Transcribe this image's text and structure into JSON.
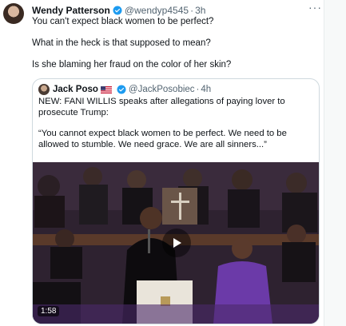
{
  "tweet": {
    "author_name": "Wendy Patterson",
    "author_handle": "@wendyp4545",
    "separator": "·",
    "time": "3h",
    "more_label": "···",
    "lines": [
      "You can't expect black women to be perfect?",
      "What in the heck is that supposed to mean?",
      "Is she blaming her fraud on the color of her skin?"
    ]
  },
  "quote": {
    "author_name": "Jack Poso",
    "author_handle": "@JackPosobiec",
    "separator": "·",
    "time": "4h",
    "text_1": "NEW: FANI WILLIS speaks after allegations of paying lover to prosecute Trump:",
    "text_2": "“You cannot expect black women to be perfect. We need to be allowed to stumble. We need grace. We are all sinners...”",
    "video_duration": "1:58"
  },
  "colors": {
    "verified_blue": "#1d9bf0",
    "secondary_text": "#536471",
    "border": "#cfd9de"
  },
  "icons": {
    "verified": "verified-badge-icon",
    "flag": "us-flag-icon",
    "play": "play-icon",
    "more": "more-horizontal-icon"
  }
}
